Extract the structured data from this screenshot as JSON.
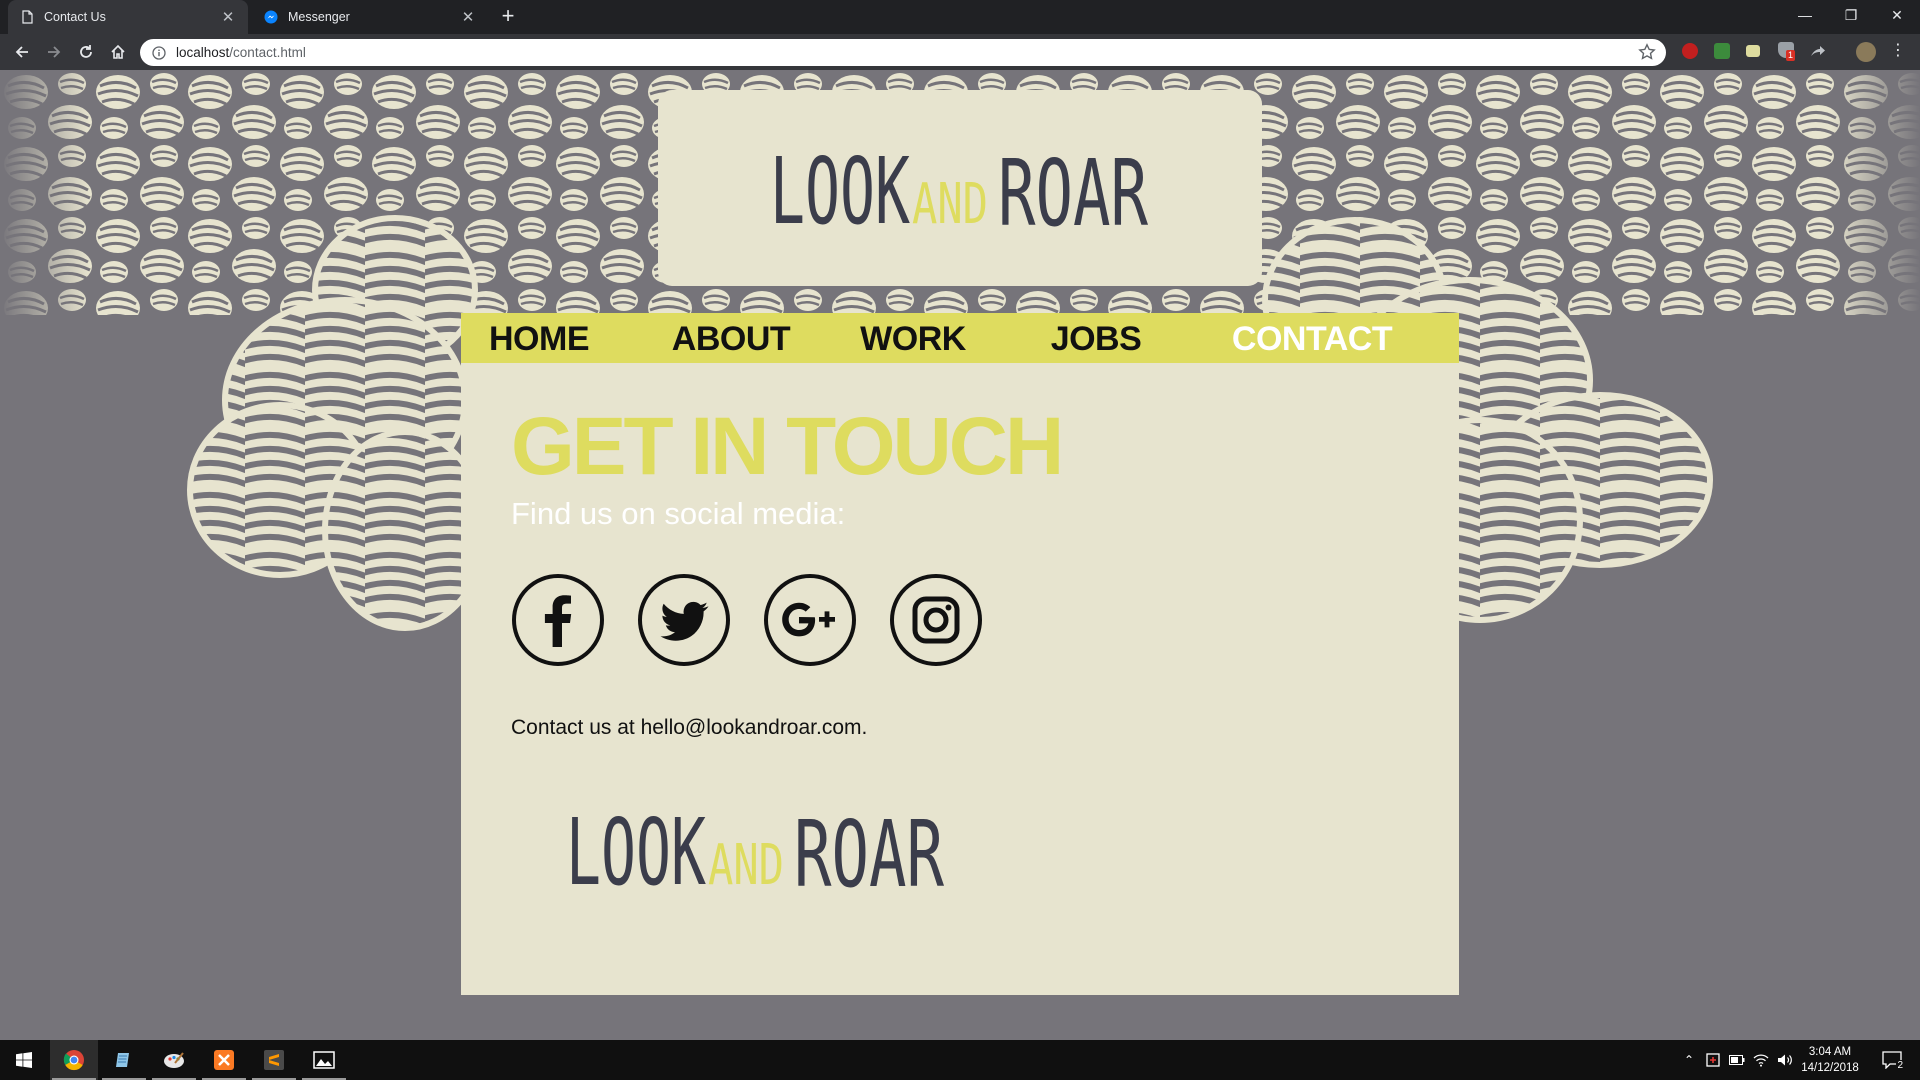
{
  "browser": {
    "tabs": [
      {
        "title": "Contact Us",
        "icon": "page-icon",
        "active": true
      },
      {
        "title": "Messenger",
        "icon": "messenger-icon",
        "active": false
      }
    ],
    "new_tab": "+",
    "window_controls": {
      "minimize": "—",
      "restore": "❐",
      "close": "✕"
    },
    "url": {
      "host": "localhost",
      "path": "/contact.html"
    },
    "extensions": [
      "opera-icon",
      "chrome-extension-icon",
      "note-extension-icon",
      "shield-extension-icon",
      "share-extension-icon"
    ],
    "extension_badge": "1"
  },
  "site": {
    "logo": {
      "word1": "LOOK",
      "word2": "AND",
      "word3": "ROAR"
    },
    "nav": [
      {
        "label": "HOME",
        "current": false
      },
      {
        "label": "ABOUT",
        "current": false
      },
      {
        "label": "WORK",
        "current": false
      },
      {
        "label": "JOBS",
        "current": false
      },
      {
        "label": "CONTACT",
        "current": true
      }
    ],
    "heading": "GET IN TOUCH",
    "subheading": "Find us on social media:",
    "social": [
      "facebook-icon",
      "twitter-icon",
      "google-plus-icon",
      "instagram-icon"
    ],
    "contact_text": "Contact us at hello@lookandroar.com.",
    "colors": {
      "background": "#76747a",
      "panel": "#e7e4cf",
      "accent": "#dedc5f",
      "logo_dark": "#3b3d4b"
    }
  },
  "taskbar": {
    "apps": [
      "windows-start-icon",
      "chrome-icon",
      "notepad-icon",
      "paint-icon",
      "xampp-icon",
      "sublime-icon",
      "photos-icon"
    ],
    "clock": {
      "time": "3:04 AM",
      "date": "14/12/2018"
    },
    "notification_count": "2"
  }
}
